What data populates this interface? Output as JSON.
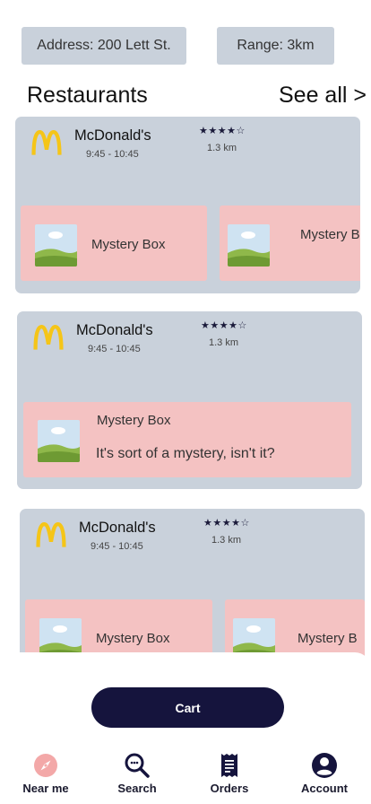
{
  "header": {
    "address": "Address: 200 Lett St.",
    "range": "Range: 3km"
  },
  "section": {
    "title": "Restaurants",
    "see_all": "See all >"
  },
  "restaurants": [
    {
      "name": "McDonald's",
      "hours": "9:45 - 10:45",
      "stars": "★★★★☆",
      "rating": 4,
      "distance": "1.3 km",
      "offers": [
        {
          "label": "Mystery Box"
        },
        {
          "label": "Mystery B"
        }
      ]
    },
    {
      "name": "McDonald's",
      "hours": "9:45 - 10:45",
      "stars": "★★★★☆",
      "rating": 4,
      "distance": "1.3 km",
      "offers": [
        {
          "label": "Mystery Box",
          "description": "It's sort of a mystery, isn't it?"
        }
      ]
    },
    {
      "name": "McDonald's",
      "hours": "9:45 - 10:45",
      "stars": "★★★★☆",
      "rating": 4,
      "distance": "1.3 km",
      "offers": [
        {
          "label": "Mystery Box"
        },
        {
          "label": "Mystery B"
        }
      ]
    }
  ],
  "cart": {
    "label": "Cart"
  },
  "nav": {
    "items": [
      {
        "label": "Near me",
        "icon": "compass-icon",
        "active": true
      },
      {
        "label": "Search",
        "icon": "search-icon"
      },
      {
        "label": "Orders",
        "icon": "receipt-icon"
      },
      {
        "label": "Account",
        "icon": "account-icon"
      }
    ]
  },
  "colors": {
    "card_bg": "#c9d1db",
    "offer_bg": "#f4c2c2",
    "primary": "#15143d",
    "logo_yellow": "#f5c518",
    "nav_active": "#f3a8a8"
  }
}
